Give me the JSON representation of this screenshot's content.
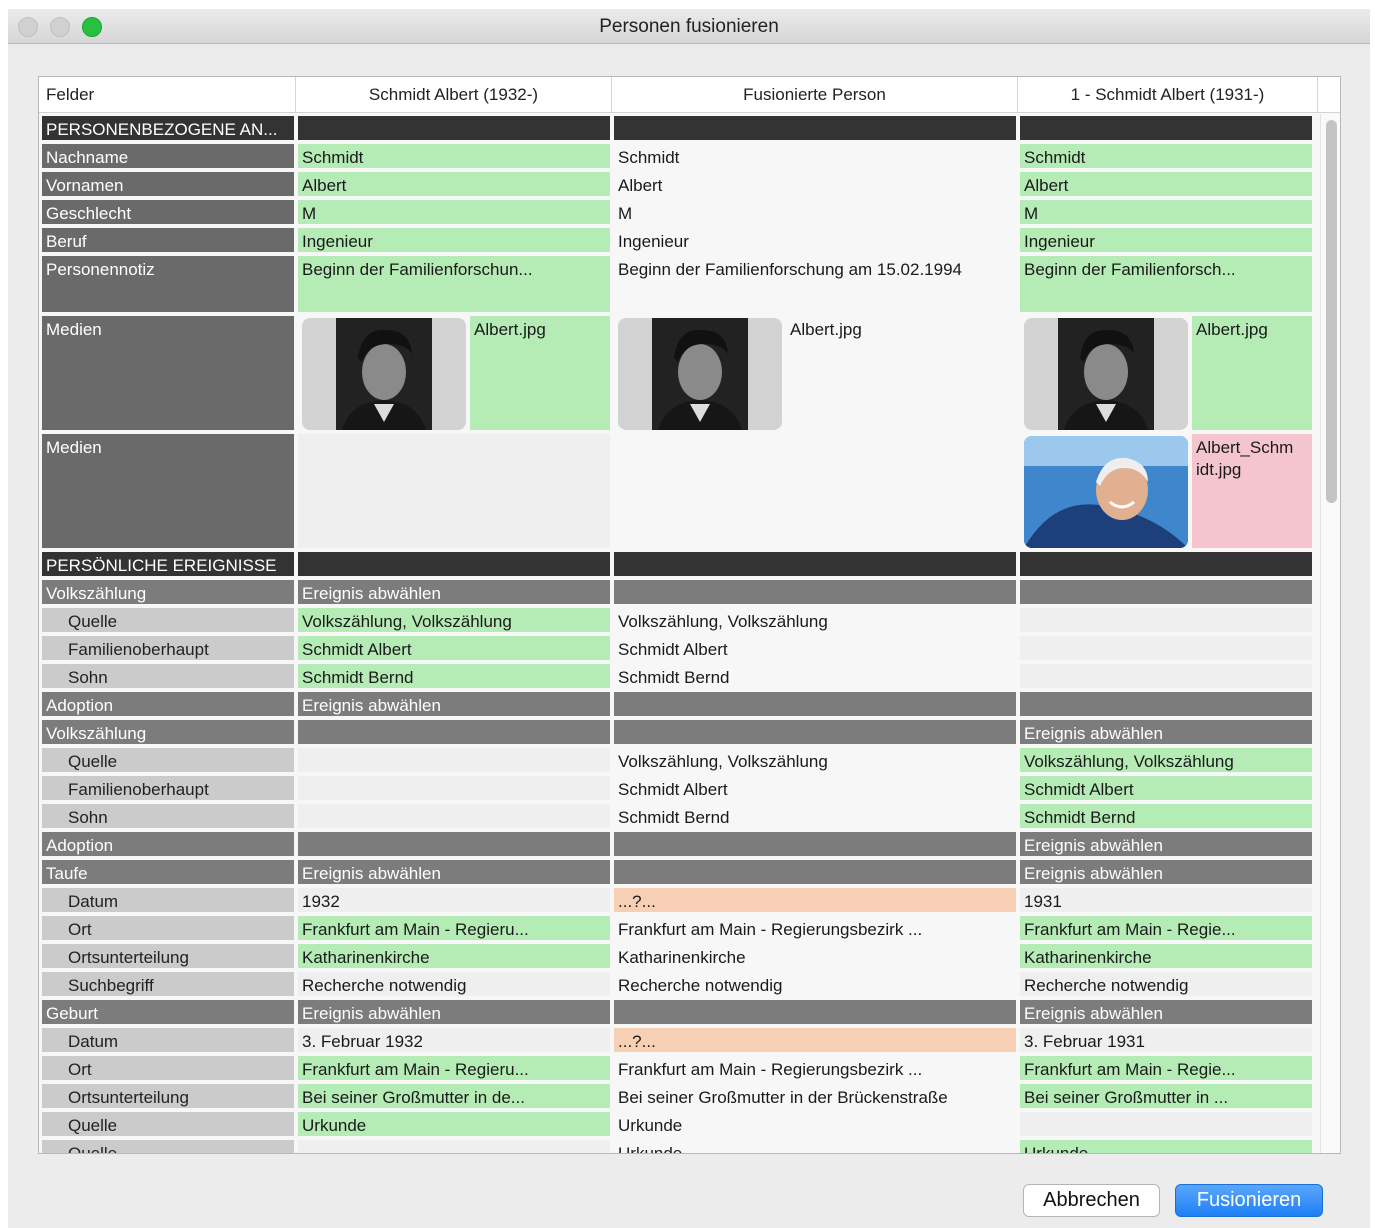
{
  "window": {
    "title": "Personen fusionieren"
  },
  "header": {
    "col0": "Felder",
    "col1": "Schmidt Albert (1932-)",
    "col2": "Fusionierte Person",
    "col3": "1 - Schmidt Albert (1931-)"
  },
  "sections": {
    "personal": "PERSONENBEZOGENE AN...",
    "events": "PERSÖNLICHE EREIGNISSE"
  },
  "fields": {
    "nachname": {
      "label": "Nachname",
      "a": "Schmidt",
      "m": "Schmidt",
      "b": "Schmidt"
    },
    "vornamen": {
      "label": "Vornamen",
      "a": "Albert",
      "m": "Albert",
      "b": "Albert"
    },
    "geschlecht": {
      "label": "Geschlecht",
      "a": "M",
      "m": "M",
      "b": "M"
    },
    "beruf": {
      "label": "Beruf",
      "a": "Ingenieur",
      "m": "Ingenieur",
      "b": "Ingenieur"
    },
    "notiz": {
      "label": "Personennotiz",
      "a": "Beginn der Familienforschun...",
      "m": "Beginn der Familienforschung am 15.02.1994",
      "b": "Beginn der Familienforsch..."
    },
    "medien1": {
      "label": "Medien",
      "a": "Albert.jpg",
      "m": "Albert.jpg",
      "b": "Albert.jpg"
    },
    "medien2": {
      "label": "Medien",
      "b": "Albert_Schm idt.jpg"
    }
  },
  "events": {
    "deselect": "Ereignis abwählen",
    "census1": {
      "label": "Volkszählung",
      "quelle_l": "Quelle",
      "quelle": "Volkszählung, Volkszählung",
      "head_l": "Familienoberhaupt",
      "head": "Schmidt Albert",
      "son_l": "Sohn",
      "son": "Schmidt Bernd"
    },
    "adoption": "Adoption",
    "census2": {
      "label": "Volkszählung"
    },
    "taufe": {
      "label": "Taufe",
      "datum_l": "Datum",
      "a_datum": "1932",
      "m_datum": "...?...",
      "b_datum": "1931",
      "ort_l": "Ort",
      "a_ort": "Frankfurt am Main - Regieru...",
      "m_ort": "Frankfurt am Main - Regierungsbezirk ...",
      "b_ort": "Frankfurt am Main - Regie...",
      "teil_l": "Ortsunterteilung",
      "teil": "Katharinenkirche",
      "such_l": "Suchbegriff",
      "such": "Recherche notwendig"
    },
    "geburt": {
      "label": "Geburt",
      "datum_l": "Datum",
      "a_datum": "3. Februar 1932",
      "m_datum": "...?...",
      "b_datum": "3. Februar 1931",
      "ort_l": "Ort",
      "a_ort": "Frankfurt am Main - Regieru...",
      "m_ort": "Frankfurt am Main - Regierungsbezirk ...",
      "b_ort": "Frankfurt am Main - Regie...",
      "teil_l": "Ortsunterteilung",
      "a_teil": "Bei seiner Großmutter in de...",
      "m_teil": "Bei seiner Großmutter in der Brückenstraße",
      "b_teil": "Bei seiner Großmutter in ...",
      "quelle_l": "Quelle",
      "quelle": "Urkunde"
    }
  },
  "buttons": {
    "cancel": "Abbrechen",
    "merge": "Fusionieren"
  },
  "colors": {
    "selected": "#b5ecb5",
    "conflict": "#f6cfb5",
    "rejected": "#f5c5cf",
    "primary": "#1e7ff5"
  }
}
